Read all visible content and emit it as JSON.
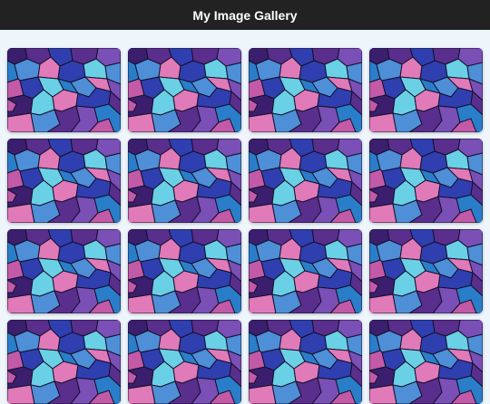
{
  "header": {
    "title": "My Image Gallery"
  },
  "gallery": {
    "image_count": 16,
    "image_subject": "purple-blue-geometric-polygon-mosaic"
  },
  "colors": {
    "header_bg": "#222222",
    "page_bg": "#eef6fc",
    "palette": [
      "#3b1f6e",
      "#5a2e8c",
      "#2f3fb0",
      "#4e8fd8",
      "#6ad0e6",
      "#c25aa8",
      "#e07ab8",
      "#2a7ec9",
      "#7a4fb6"
    ]
  }
}
